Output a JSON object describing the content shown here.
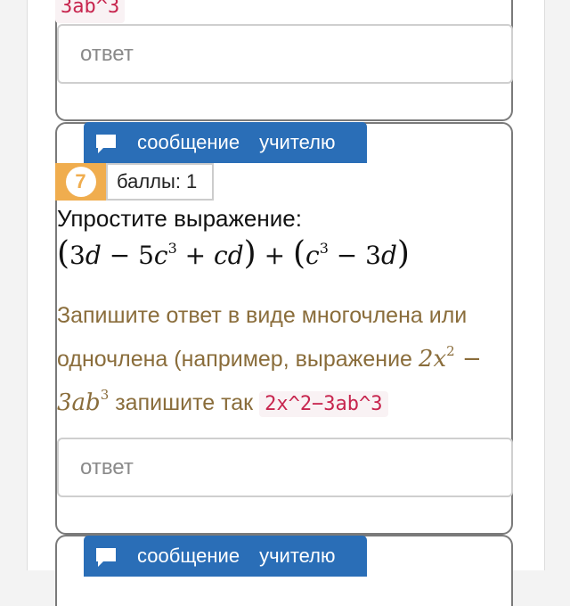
{
  "previous_task": {
    "example_code_tail": "3ab^3",
    "answer_placeholder": "ответ"
  },
  "task": {
    "message_button": {
      "label_part1": "сообщение",
      "label_part2": "учителю"
    },
    "number": "7",
    "points_label": "баллы: 1",
    "title": "Упростите выражение:",
    "expression": "(3d − 5c³ + cd) + (c³ − 3d)",
    "instructions": {
      "line1": "Запишите ответ в виде многочлена или одночлена (например, выражение",
      "example_math": "2x² − 3ab³",
      "mid_text": "запишите так",
      "example_code": "2x^2−3ab^3"
    },
    "answer_placeholder": "ответ"
  },
  "next_task": {
    "message_button": {
      "label_part1": "сообщение",
      "label_part2": "учителю"
    }
  },
  "colors": {
    "button_blue": "#2a6eb7",
    "badge_orange": "#f0ad4e",
    "instruction_brown": "#8a6d3b",
    "code_red": "#c7254e"
  }
}
